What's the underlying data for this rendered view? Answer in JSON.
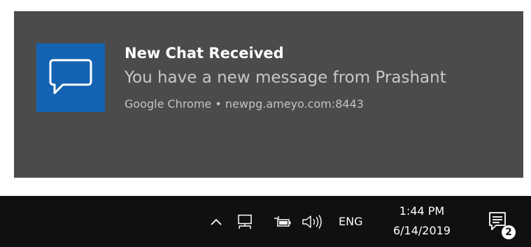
{
  "toast": {
    "icon": "chat-bubble-icon",
    "title": "New Chat Received",
    "message": "You have a new message from Prashant",
    "source": "Google Chrome • newpg.ameyo.com:8443",
    "colors": {
      "background": "#4b4b4b",
      "icon_tile": "#1463b3"
    }
  },
  "taskbar": {
    "tray_icons": [
      "chevron-up-icon",
      "network-icon",
      "battery-icon",
      "speaker-icon"
    ],
    "language": "ENG",
    "time": "1:44 PM",
    "date": "6/14/2019",
    "notification_count": "2",
    "colors": {
      "background": "#101010"
    }
  }
}
